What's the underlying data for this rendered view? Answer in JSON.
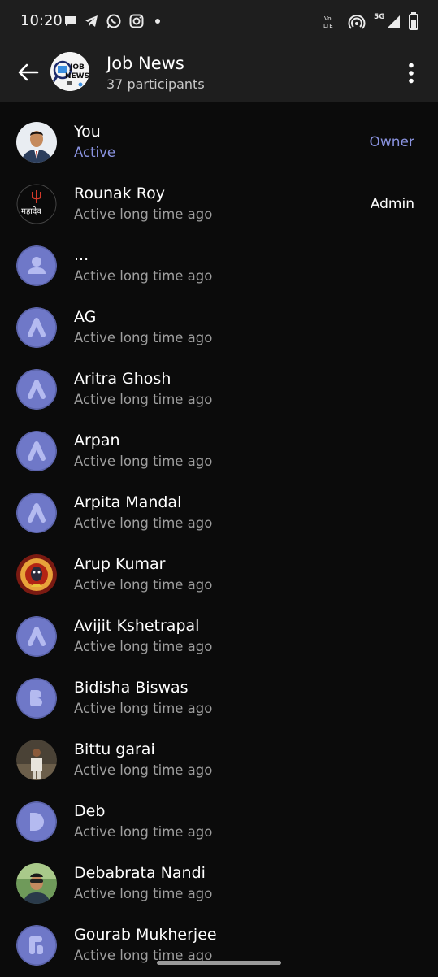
{
  "status_bar": {
    "time": "10:20",
    "network_label": "5G",
    "volte_label": "Vo\nLTE"
  },
  "header": {
    "title": "Job News",
    "subtitle": "37 participants",
    "avatar_text_top": "JOB",
    "avatar_text_bottom": "NEWS"
  },
  "members": [
    {
      "name": "You",
      "status": "Active",
      "role": "Owner",
      "avatar": "photo-man-suit"
    },
    {
      "name": "Rounak Roy",
      "status": "Active long time ago",
      "role": "Admin",
      "avatar": "mahadev-logo",
      "avatar_text": "महादेव"
    },
    {
      "name": "...",
      "status": "Active long time ago",
      "role": "",
      "avatar": "default-person"
    },
    {
      "name": "AG",
      "status": "Active long time ago",
      "role": "",
      "avatar": "letter-a"
    },
    {
      "name": "Aritra Ghosh",
      "status": "Active long time ago",
      "role": "",
      "avatar": "letter-a"
    },
    {
      "name": "Arpan",
      "status": "Active long time ago",
      "role": "",
      "avatar": "letter-a"
    },
    {
      "name": "Arpita Mandal",
      "status": "Active long time ago",
      "role": "",
      "avatar": "letter-a"
    },
    {
      "name": "Arup Kumar",
      "status": "Active long time ago",
      "role": "",
      "avatar": "photo-deity"
    },
    {
      "name": "Avijit Kshetrapal",
      "status": "Active long time ago",
      "role": "",
      "avatar": "letter-a"
    },
    {
      "name": "Bidisha Biswas",
      "status": "Active long time ago",
      "role": "",
      "avatar": "letter-b"
    },
    {
      "name": "Bittu garai",
      "status": "Active long time ago",
      "role": "",
      "avatar": "photo-man-standing"
    },
    {
      "name": "Deb",
      "status": "Active long time ago",
      "role": "",
      "avatar": "letter-d"
    },
    {
      "name": "Debabrata Nandi",
      "status": "Active long time ago",
      "role": "",
      "avatar": "photo-man-outdoor"
    },
    {
      "name": "Gourab Mukherjee",
      "status": "Active long time ago",
      "role": "",
      "avatar": "letter-g"
    }
  ],
  "colors": {
    "background": "#0b0b0b",
    "header": "#1e1e1e",
    "accent": "#8a93e0",
    "avatar_circle": "#6f78c8",
    "avatar_glyph": "#b4baf0"
  }
}
